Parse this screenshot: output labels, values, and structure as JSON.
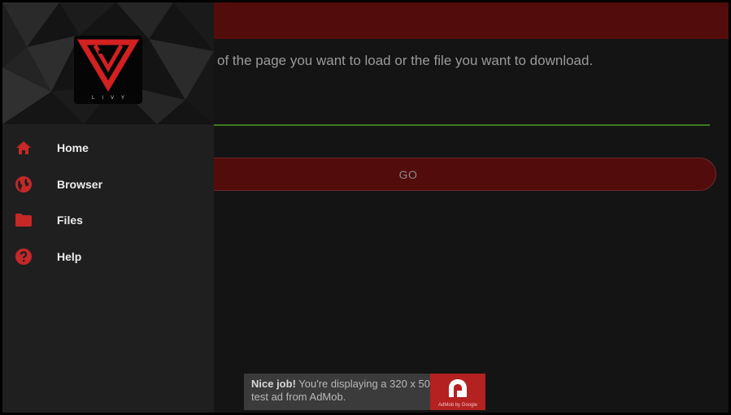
{
  "app": {
    "logo_text": "LIVY",
    "accent_color": "#c62828",
    "header_color": "#530c0c"
  },
  "main": {
    "instruction": "Type the URL of the page you want to load or the file you want to download.",
    "url_input": {
      "value": "",
      "placeholder": ""
    },
    "go_label": "GO"
  },
  "drawer": {
    "items": [
      {
        "label": "Home",
        "icon": "home-icon"
      },
      {
        "label": "Browser",
        "icon": "globe-icon"
      },
      {
        "label": "Files",
        "icon": "folder-icon"
      },
      {
        "label": "Help",
        "icon": "help-icon"
      }
    ]
  },
  "ad": {
    "headline": "Nice job!",
    "body": " You're displaying a 320 x 50 test ad from AdMob.",
    "logo_caption": "AdMob by Google"
  }
}
